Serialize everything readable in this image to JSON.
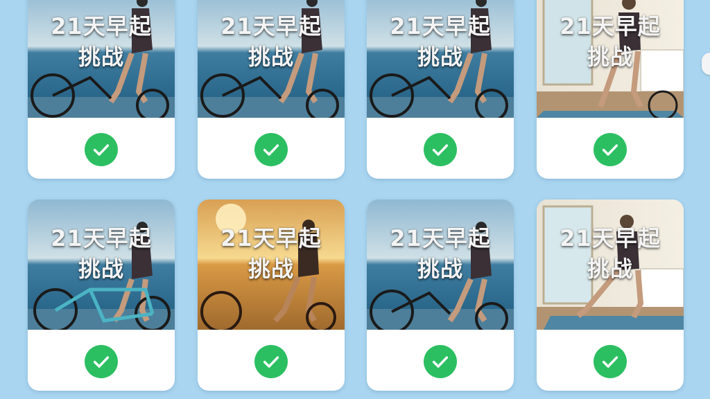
{
  "cards": [
    {
      "line1": "21天早起",
      "line2": "挑战",
      "scene": "sea-bike",
      "status": "completed"
    },
    {
      "line1": "21天早起",
      "line2": "挑战",
      "scene": "sea-bike",
      "status": "completed"
    },
    {
      "line1": "21天早起",
      "line2": "挑战",
      "scene": "sea-bike",
      "status": "completed"
    },
    {
      "line1": "21天早起",
      "line2": "挑战",
      "scene": "indoor-yoga",
      "status": "completed"
    },
    {
      "line1": "21天早起",
      "line2": "挑战",
      "scene": "sea-bike-teal",
      "status": "completed"
    },
    {
      "line1": "21天早起",
      "line2": "挑战",
      "scene": "sunset-bike",
      "status": "completed"
    },
    {
      "line1": "21天早起",
      "line2": "挑战",
      "scene": "sea-bike",
      "status": "completed"
    },
    {
      "line1": "21天早起",
      "line2": "挑战",
      "scene": "indoor-yoga",
      "status": "completed"
    }
  ],
  "colors": {
    "background": "#a9d5f0",
    "check": "#2cbf62",
    "card": "#ffffff"
  },
  "icons": {
    "status": "checkmark-icon"
  }
}
